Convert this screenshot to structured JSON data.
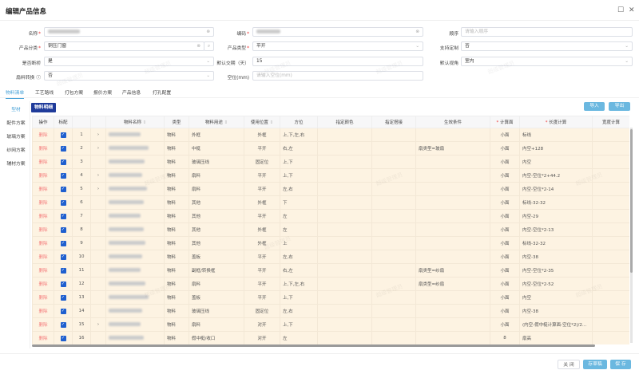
{
  "title": "编辑产品信息",
  "form": {
    "name": {
      "label": "名称",
      "value": ""
    },
    "code": {
      "label": "编码",
      "value": ""
    },
    "order": {
      "label": "顺序",
      "placeholder": "请输入顺序"
    },
    "category": {
      "label": "产品分类",
      "value": "铜压门窗"
    },
    "type": {
      "label": "产品类型",
      "value": "平开"
    },
    "custom": {
      "label": "支持定制",
      "value": "否"
    },
    "broken": {
      "label": "是否断桥",
      "value": "是"
    },
    "delivery": {
      "label": "默认交期（天）",
      "value": "15"
    },
    "view": {
      "label": "默认视角",
      "value": "室内"
    },
    "convert": {
      "label": "扇料转换",
      "value": "否"
    },
    "gap": {
      "label": "空位(mm)",
      "placeholder": "请输入空位(mm)"
    }
  },
  "tabs": [
    "物料清单",
    "工艺路线",
    "打包方案",
    "报价方案",
    "产品信息",
    "打孔配置"
  ],
  "side": [
    "型材",
    "配件方案",
    "玻璃方案",
    "纱网方案",
    "辅材方案"
  ],
  "subtab": "物料明细",
  "import_label": "导入",
  "export_label": "导出",
  "columns": [
    "操作",
    "标配",
    "",
    "",
    "物料名称",
    "类型",
    "物料用途",
    "使用位置",
    "方位",
    "指定颜色",
    "指定搭接",
    "生效条件",
    "计算面",
    "长度计算",
    "宽度计算"
  ],
  "rows": [
    {
      "i": "1",
      "e": true,
      "t": "物料",
      "u": "外框",
      "p": "外框",
      "d": "上,下,左,右",
      "cond": "",
      "f": "小面",
      "len": "标线"
    },
    {
      "i": "2",
      "e": true,
      "t": "物料",
      "u": "中梃",
      "p": "平开",
      "d": "右,左",
      "cond": "扇类型=玻扇",
      "f": "小面",
      "len": "内空+128"
    },
    {
      "i": "3",
      "e": false,
      "t": "物料",
      "u": "玻璃压线",
      "p": "固定位",
      "d": "上,下",
      "cond": "",
      "f": "小面",
      "len": "内空"
    },
    {
      "i": "4",
      "e": true,
      "t": "物料",
      "u": "扇料",
      "p": "平开",
      "d": "上,下",
      "cond": "",
      "f": "小面",
      "len": "内空-空位*2+44.2"
    },
    {
      "i": "5",
      "e": true,
      "t": "物料",
      "u": "扇料",
      "p": "平开",
      "d": "左,右",
      "cond": "",
      "f": "小面",
      "len": "内空-空位*2-14"
    },
    {
      "i": "6",
      "e": false,
      "t": "物料",
      "u": "其他",
      "p": "外框",
      "d": "下",
      "cond": "",
      "f": "小面",
      "len": "标线-32-32"
    },
    {
      "i": "7",
      "e": false,
      "t": "物料",
      "u": "其他",
      "p": "平开",
      "d": "左",
      "cond": "",
      "f": "小面",
      "len": "内空-29"
    },
    {
      "i": "8",
      "e": false,
      "t": "物料",
      "u": "其他",
      "p": "外框",
      "d": "左",
      "cond": "",
      "f": "小面",
      "len": "内空-空位*2-13"
    },
    {
      "i": "9",
      "e": false,
      "t": "物料",
      "u": "其他",
      "p": "外框",
      "d": "上",
      "cond": "",
      "f": "小面",
      "len": "标线-32-32"
    },
    {
      "i": "10",
      "e": false,
      "t": "物料",
      "u": "盖板",
      "p": "平开",
      "d": "左,右",
      "cond": "",
      "f": "小面",
      "len": "内空-38"
    },
    {
      "i": "11",
      "e": false,
      "t": "物料",
      "u": "副框/转换框",
      "p": "平开",
      "d": "右,左",
      "cond": "扇类型=纱扇",
      "f": "小面",
      "len": "内空-空位*2-35"
    },
    {
      "i": "12",
      "e": false,
      "t": "物料",
      "u": "扇料",
      "p": "平开",
      "d": "上,下,左,右",
      "cond": "扇类型=纱扇",
      "f": "小面",
      "len": "内空-空位*2-52"
    },
    {
      "i": "13",
      "e": false,
      "t": "物料",
      "u": "盖板",
      "p": "平开",
      "d": "上,下",
      "cond": "",
      "f": "小面",
      "len": "内空"
    },
    {
      "i": "14",
      "e": false,
      "t": "物料",
      "u": "玻璃压线",
      "p": "固定位",
      "d": "左,右",
      "cond": "",
      "f": "小面",
      "len": "内空-38"
    },
    {
      "i": "15",
      "e": true,
      "t": "物料",
      "u": "扇料",
      "p": "对开",
      "d": "上,下",
      "cond": "",
      "f": "小面",
      "len": "(内空-假中梃计算面-空位*2)/2+..."
    },
    {
      "i": "16",
      "e": false,
      "t": "物料",
      "u": "假中梃/收口",
      "p": "对开",
      "d": "左",
      "cond": "",
      "f": "8",
      "len": "扇高"
    }
  ],
  "delete_label": "删除",
  "footer": {
    "close": "关 闭",
    "draft": "存草稿",
    "save": "保 存"
  },
  "colors": {
    "accent": "#4aa3d8",
    "row_bg": "#fdf3e2",
    "checkbox": "#1f5fcf"
  }
}
